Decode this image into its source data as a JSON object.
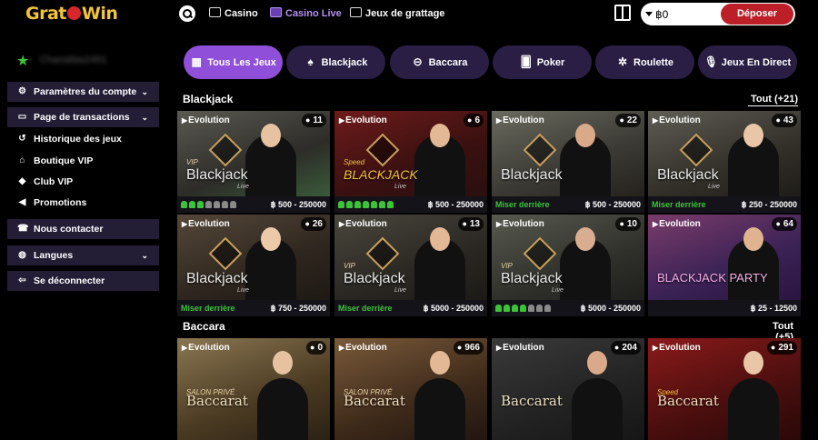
{
  "header": {
    "logo": "GratoWin",
    "nav": [
      {
        "label": "Casino",
        "icon": "slot-machine-icon",
        "active": false
      },
      {
        "label": "Casino Live",
        "icon": "live-casino-icon",
        "active": true
      },
      {
        "label": "Jeux de grattage",
        "icon": "scratch-card-icon",
        "active": false
      }
    ],
    "balance": "฿0",
    "deposit_label": "Déposer"
  },
  "sidebar": {
    "username": "Chanallas2461",
    "items": [
      {
        "label": "Paramètres du compte",
        "icon": "gear-icon",
        "chevron": true
      },
      {
        "label": "Page de transactions",
        "icon": "wallet-icon",
        "chevron": true
      },
      {
        "label": "Historique des jeux",
        "icon": "history-icon",
        "chevron": false
      },
      {
        "label": "Boutique VIP",
        "icon": "shop-icon",
        "chevron": false
      },
      {
        "label": "Club VIP",
        "icon": "diamond-icon",
        "chevron": false
      },
      {
        "label": "Promotions",
        "icon": "megaphone-icon",
        "chevron": false
      },
      {
        "label": "Nous contacter",
        "icon": "phone-icon",
        "chevron": false
      },
      {
        "label": "Langues",
        "icon": "globe-icon",
        "chevron": true
      },
      {
        "label": "Se déconnecter",
        "icon": "logout-icon",
        "chevron": false
      }
    ]
  },
  "tabs": [
    {
      "label": "Tous Les Jeux",
      "icon": "grid-icon",
      "active": true
    },
    {
      "label": "Blackjack",
      "icon": "spade-icon",
      "active": false
    },
    {
      "label": "Baccara",
      "icon": "baccarat-table-icon",
      "active": false
    },
    {
      "label": "Poker",
      "icon": "cards-icon",
      "active": false
    },
    {
      "label": "Roulette",
      "icon": "roulette-icon",
      "active": false
    },
    {
      "label": "Jeux En Direct",
      "icon": "microphone-icon",
      "active": false
    }
  ],
  "sections": {
    "blackjack": {
      "title": "Blackjack",
      "more": "Tout (+21)"
    },
    "baccara": {
      "title": "Baccara",
      "more": "Tout (+5)"
    }
  },
  "blackjack_cards": [
    {
      "brand": "Evolution",
      "count": "11",
      "title": "Blackjack",
      "subtitle": "VIP",
      "sub2": "Live",
      "footer_type": "seats",
      "seats": 7,
      "seats_taken": 3,
      "limits": "฿ 500 - 250000"
    },
    {
      "brand": "Evolution",
      "count": "6",
      "title": "BLACKJACK",
      "subtitle": "Speed",
      "sub2": "Live",
      "footer_type": "seats",
      "seats": 7,
      "seats_taken": 7,
      "limits": "฿ 500 - 250000"
    },
    {
      "brand": "Evolution",
      "count": "22",
      "title": "Blackjack",
      "subtitle": "",
      "sub2": "",
      "footer_type": "behind",
      "behind_label": "Miser derrière",
      "limits": "฿ 500 - 250000"
    },
    {
      "brand": "Evolution",
      "count": "43",
      "title": "Blackjack",
      "subtitle": "",
      "sub2": "Live",
      "footer_type": "behind",
      "behind_label": "Miser derrière",
      "limits": "฿ 250 - 250000"
    },
    {
      "brand": "Evolution",
      "count": "26",
      "title": "Blackjack",
      "subtitle": "",
      "sub2": "Live",
      "footer_type": "behind",
      "behind_label": "Miser derrière",
      "limits": "฿ 750 - 250000"
    },
    {
      "brand": "Evolution",
      "count": "13",
      "title": "Blackjack",
      "subtitle": "VIP",
      "sub2": "Live",
      "footer_type": "behind",
      "behind_label": "Miser derrière",
      "limits": "฿ 5000 - 250000"
    },
    {
      "brand": "Evolution",
      "count": "10",
      "title": "Blackjack",
      "subtitle": "VIP",
      "sub2": "Live",
      "footer_type": "seats",
      "seats": 7,
      "seats_taken": 4,
      "limits": "฿ 5000 - 250000"
    },
    {
      "brand": "Evolution",
      "count": "64",
      "title": "BLACKJACK PARTY",
      "subtitle": "",
      "sub2": "",
      "footer_type": "plain",
      "limits": "฿ 25 - 12500"
    }
  ],
  "baccara_cards": [
    {
      "brand": "Evolution",
      "count": "0",
      "title": "Baccarat",
      "subtitle": "SALON PRIVÉ",
      "sub2": ""
    },
    {
      "brand": "Evolution",
      "count": "966",
      "title": "Baccarat",
      "subtitle": "SALON PRIVÉ",
      "sub2": ""
    },
    {
      "brand": "Evolution",
      "count": "204",
      "title": "Baccarat",
      "subtitle": "",
      "sub2": ""
    },
    {
      "brand": "Evolution",
      "count": "291",
      "title": "Baccarat",
      "subtitle": "Speed",
      "sub2": ""
    }
  ],
  "colors": {
    "accent": "#8f4fd8",
    "tab_bg": "#2a1e44",
    "deposit": "#bd1f28",
    "green": "#3cc437",
    "logo": "#f3c436"
  }
}
